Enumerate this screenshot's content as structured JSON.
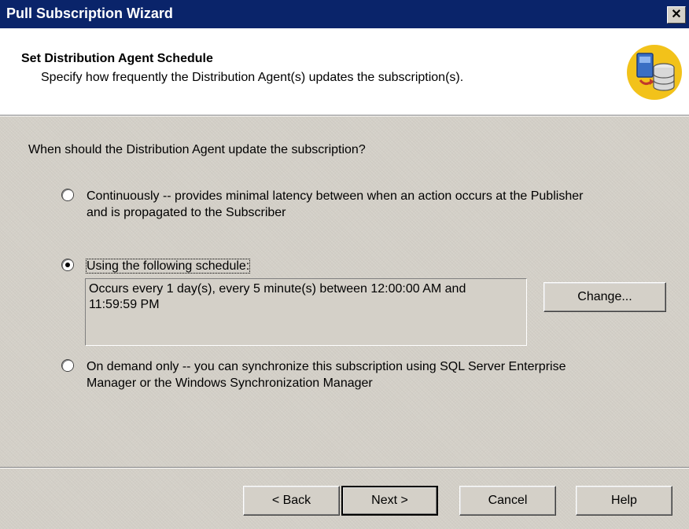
{
  "window": {
    "title": "Pull Subscription Wizard",
    "close_glyph": "✕"
  },
  "header": {
    "title": "Set Distribution Agent Schedule",
    "subtitle": "Specify how frequently the Distribution Agent(s) updates the subscription(s).",
    "logo_icon": "server-database-icon"
  },
  "question": "When should the Distribution Agent update the subscription?",
  "options": [
    {
      "label_line1": "Continuously -- provides minimal latency between when an action occurs at the Publisher",
      "label_line2": "and is propagated to the Subscriber",
      "checked": false
    },
    {
      "label_line1": "Using the following schedule:",
      "checked": true
    },
    {
      "label_line1": "On demand only -- you can synchronize this subscription using SQL Server Enterprise",
      "label_line2": "Manager or the Windows Synchronization Manager",
      "checked": false
    }
  ],
  "schedule": {
    "line1": "Occurs every 1 day(s), every 5 minute(s) between 12:00:00 AM and",
    "line2": "11:59:59 PM",
    "change_button": "Change..."
  },
  "footer": {
    "back": "< Back",
    "next": "Next >",
    "cancel": "Cancel",
    "help": "Help"
  },
  "colors": {
    "titlebar": "#0a246a",
    "face": "#d4d0c8",
    "logo_bg": "#f2c21a"
  }
}
